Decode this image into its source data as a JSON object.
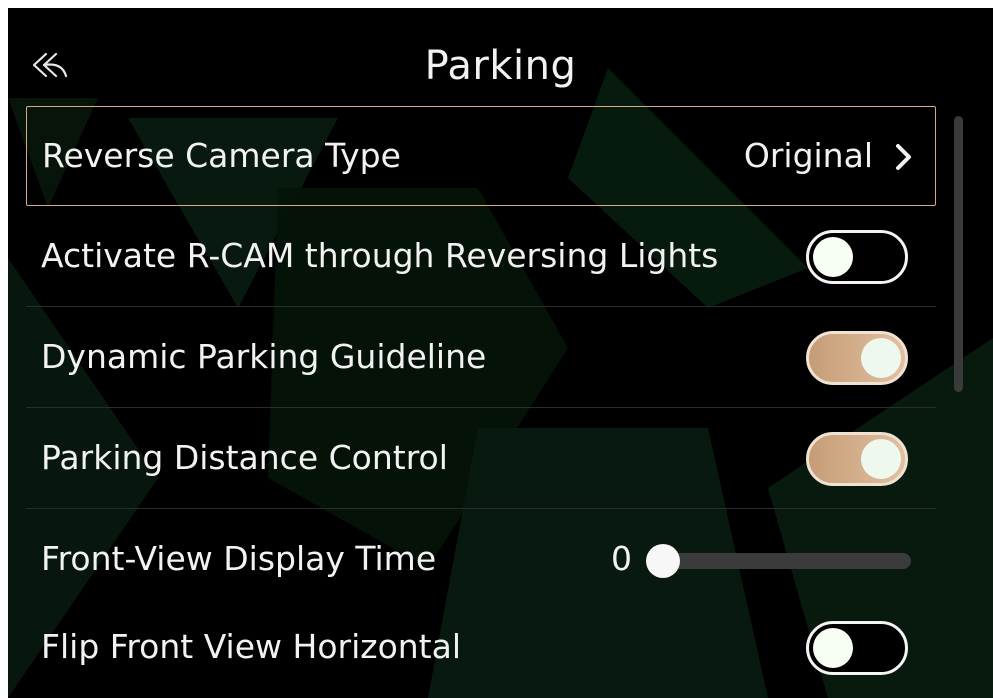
{
  "header": {
    "title": "Parking",
    "back_icon": "back-arrow-icon"
  },
  "settings": [
    {
      "label": "Reverse Camera Type",
      "type": "submenu",
      "value": "Original",
      "focused": true
    },
    {
      "label": "Activate R-CAM through Reversing Lights",
      "type": "toggle",
      "state": "off"
    },
    {
      "label": "Dynamic Parking Guideline",
      "type": "toggle",
      "state": "on"
    },
    {
      "label": "Parking Distance Control",
      "type": "toggle",
      "state": "on"
    },
    {
      "label": "Front-View Display Time",
      "type": "slider",
      "value": "0",
      "level": 0
    },
    {
      "label": "Flip Front View Horizontal",
      "type": "toggle",
      "state": "off"
    }
  ],
  "colors": {
    "background": "#000000",
    "text": "#f2f2f2",
    "accent": "#d7a985",
    "toggle_on": "#c69c77",
    "watermark": "#0b2a17"
  }
}
